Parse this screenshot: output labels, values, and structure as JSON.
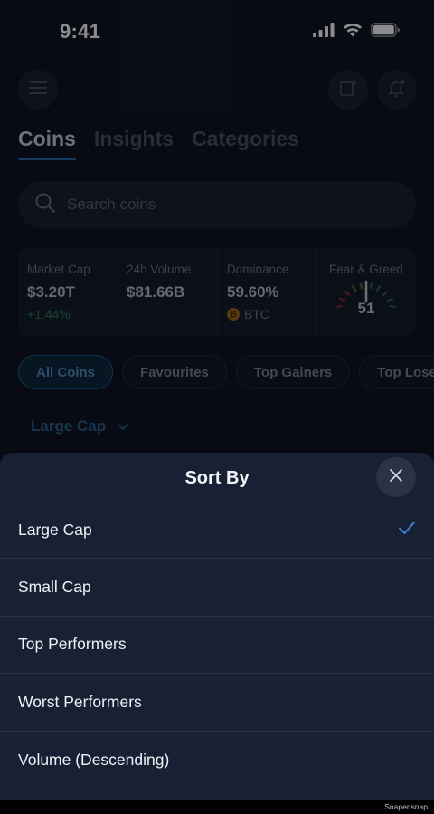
{
  "status_bar": {
    "time": "9:41"
  },
  "header": {
    "tabs": [
      {
        "label": "Coins",
        "active": true
      },
      {
        "label": "Insights",
        "active": false
      },
      {
        "label": "Categories",
        "active": false
      }
    ]
  },
  "search": {
    "placeholder": "Search coins",
    "value": ""
  },
  "stats": {
    "market_cap": {
      "label": "Market Cap",
      "value": "$3.20T",
      "change": "+1.44%"
    },
    "volume": {
      "label": "24h Volume",
      "value": "$81.66B"
    },
    "dominance": {
      "label": "Dominance",
      "value": "59.60%",
      "coin": "BTC"
    },
    "fear_greed": {
      "label": "Fear & Greed",
      "value": "51"
    }
  },
  "filters": [
    "All Coins",
    "Favourites",
    "Top Gainers",
    "Top Losers"
  ],
  "sort_trigger": {
    "label": "Large Cap"
  },
  "sheet": {
    "title": "Sort By",
    "options": [
      {
        "label": "Large Cap",
        "selected": true
      },
      {
        "label": "Small Cap",
        "selected": false
      },
      {
        "label": "Top Performers",
        "selected": false
      },
      {
        "label": "Worst Performers",
        "selected": false
      },
      {
        "label": "Volume (Descending)",
        "selected": false
      }
    ]
  },
  "watermark": "Snapensnap",
  "colors": {
    "accent": "#2f6fb3",
    "check": "#3b82d6",
    "positive": "#2e7d5e"
  }
}
